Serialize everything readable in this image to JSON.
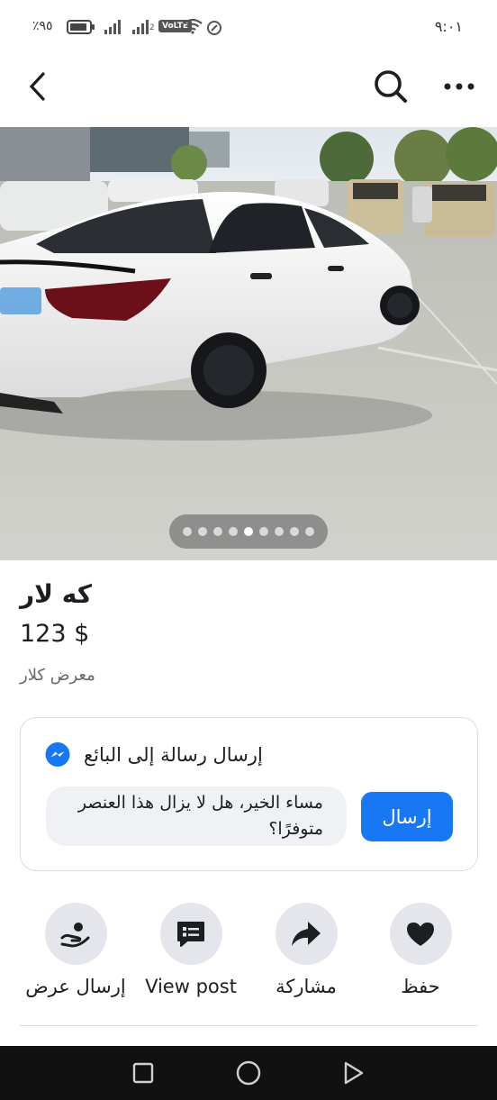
{
  "status_bar": {
    "battery": "٪٩٥",
    "sim2": "2",
    "volte": "VoLTE",
    "time": "٩:٠١"
  },
  "top_nav": {
    "back_icon": "chevron-left-icon",
    "search_icon": "search-icon",
    "more_icon": "more-horizontal-icon"
  },
  "hero": {
    "page_count": 9,
    "active_page": 5
  },
  "listing": {
    "title": "كه لار",
    "price": "123 $",
    "seller": "معرض كلار"
  },
  "message_card": {
    "header": "إرسال رسالة إلى البائع",
    "message": "مساء الخير، هل لا يزال هذا العنصر متوفرًا؟",
    "send_label": "إرسال",
    "accent": "#1877f2"
  },
  "actions": [
    {
      "label": "إرسال عرض",
      "icon": "make-offer-icon"
    },
    {
      "label": "View post",
      "icon": "post-icon"
    },
    {
      "label": "مشاركة",
      "icon": "share-icon"
    },
    {
      "label": "حفظ",
      "icon": "heart-icon"
    }
  ],
  "system_nav": {
    "recents": "square-icon",
    "home": "circle-icon",
    "back": "triangle-back-icon"
  }
}
